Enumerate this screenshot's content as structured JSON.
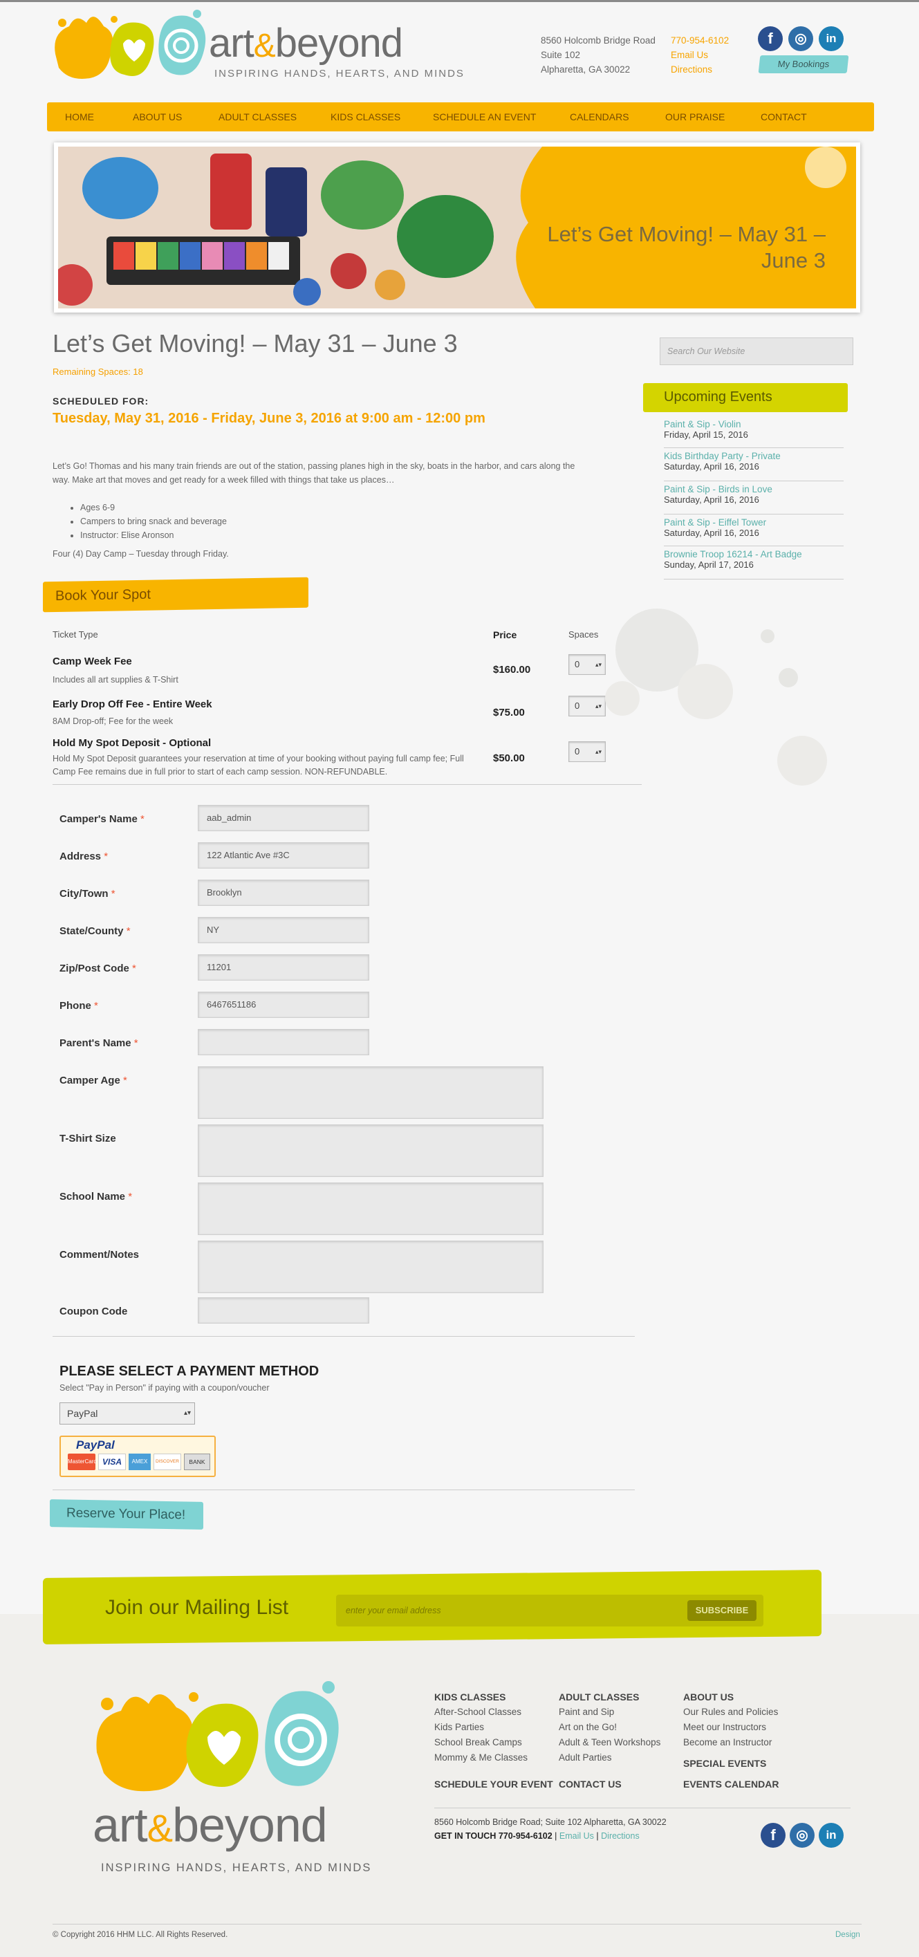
{
  "header": {
    "brand_art": "art",
    "brand_amp": "&",
    "brand_beyond": "beyond",
    "tagline": "INSPIRING HANDS, HEARTS, AND MINDS",
    "address_line1": "8560 Holcomb Bridge Road",
    "address_line2": "Suite 102",
    "address_line3": "Alpharetta, GA 30022",
    "phone": "770-954-6102",
    "email_link": "Email Us",
    "directions_link": "Directions",
    "my_bookings": "My Bookings",
    "social": {
      "facebook": "f",
      "instagram": "◎",
      "linkedin": "in"
    }
  },
  "nav": {
    "items": [
      "HOME",
      "ABOUT US",
      "ADULT CLASSES",
      "KIDS CLASSES",
      "SCHEDULE AN EVENT",
      "CALENDARS",
      "OUR PRAISE",
      "CONTACT"
    ]
  },
  "banner": {
    "title": "Let’s Get Moving! – May 31 – June 3"
  },
  "event": {
    "title": "Let’s Get Moving! – May 31 – June 3",
    "remaining": "Remaining Spaces: 18",
    "scheduled_label": "SCHEDULED FOR:",
    "scheduled_date": "Tuesday, May 31, 2016 - Friday, June 3, 2016 at 9:00 am - 12:00 pm",
    "description": "Let’s Go! Thomas and his many train friends are out of the station, passing planes high in the sky, boats in the harbor, and cars along the way. Make art that moves and get ready for a week filled with things that take us places…",
    "bullets": [
      "Ages 6-9",
      "Campers to bring snack and beverage",
      "Instructor: Elise Aronson"
    ],
    "day_camp_note": "Four (4) Day Camp – Tuesday through Friday."
  },
  "booking": {
    "section_title": "Book Your Spot",
    "col_ticket": "Ticket Type",
    "col_price": "Price",
    "col_spaces": "Spaces",
    "tickets": [
      {
        "name": "Camp Week Fee",
        "desc": "Includes all art supplies & T-Shirt",
        "price": "$160.00",
        "qty": "0"
      },
      {
        "name": "Early Drop Off Fee - Entire Week",
        "desc": "8AM Drop-off; Fee for the week",
        "price": "$75.00",
        "qty": "0"
      },
      {
        "name": "Hold My Spot Deposit - Optional",
        "desc": "Hold My Spot Deposit guarantees your reservation at time of your booking without paying full camp fee; Full Camp Fee remains due in full prior to start of each camp session. NON-REFUNDABLE.",
        "price": "$50.00",
        "qty": "0"
      }
    ]
  },
  "form": {
    "required_mark": "*",
    "fields": [
      {
        "label": "Camper's Name",
        "required": true,
        "value": "aab_admin"
      },
      {
        "label": "Address",
        "required": true,
        "value": "122 Atlantic Ave #3C"
      },
      {
        "label": "City/Town",
        "required": true,
        "value": "Brooklyn"
      },
      {
        "label": "State/County",
        "required": true,
        "value": "NY"
      },
      {
        "label": "Zip/Post Code",
        "required": true,
        "value": "11201"
      },
      {
        "label": "Phone",
        "required": true,
        "value": "6467651186"
      },
      {
        "label": "Parent's Name",
        "required": true,
        "value": ""
      }
    ],
    "textareas": [
      {
        "label": "Camper Age",
        "required": true
      },
      {
        "label": "T-Shirt Size",
        "required": false
      },
      {
        "label": "School Name",
        "required": true
      },
      {
        "label": "Comment/Notes",
        "required": false
      }
    ],
    "coupon_label": "Coupon Code",
    "coupon_value": ""
  },
  "payment": {
    "heading": "PLEASE SELECT A PAYMENT METHOD",
    "subtext": "Select \"Pay in Person\" if paying with a coupon/voucher",
    "selected": "PayPal",
    "paypal_logo": "PayPal",
    "cards": [
      "MasterCard",
      "VISA",
      "AMEX",
      "DISCOVER",
      "BANK"
    ],
    "reserve_button": "Reserve Your Place!"
  },
  "sidebar": {
    "search_placeholder": "Search Our Website",
    "upcoming_title": "Upcoming Events",
    "events": [
      {
        "title": "Paint & Sip - Violin",
        "date": "Friday, April 15, 2016"
      },
      {
        "title": "Kids Birthday Party - Private",
        "date": "Saturday, April 16, 2016"
      },
      {
        "title": "Paint & Sip - Birds in Love",
        "date": "Saturday, April 16, 2016"
      },
      {
        "title": "Paint & Sip - Eiffel Tower",
        "date": "Saturday, April 16, 2016"
      },
      {
        "title": "Brownie Troop 16214 - Art Badge",
        "date": "Sunday, April 17, 2016"
      }
    ]
  },
  "mailing": {
    "title": "Join our Mailing List",
    "placeholder": "enter your email address",
    "button": "SUBSCRIBE"
  },
  "footer": {
    "brand_art": "art",
    "brand_amp": "&",
    "brand_beyond": "beyond",
    "tagline": "INSPIRING HANDS, HEARTS, AND MINDS",
    "col1": {
      "heading": "KIDS CLASSES",
      "items": [
        "After-School Classes",
        "Kids Parties",
        "School Break Camps",
        "Mommy & Me Classes"
      ],
      "bottom": "SCHEDULE YOUR EVENT"
    },
    "col2": {
      "heading": "ADULT CLASSES",
      "items": [
        "Paint and Sip",
        "Art on the Go!",
        "Adult & Teen Workshops",
        "Adult Parties"
      ],
      "bottom": "CONTACT US"
    },
    "col3": {
      "heading": "ABOUT US",
      "items": [
        "Our Rules and Policies",
        "Meet our Instructors",
        "Become an Instructor"
      ],
      "mid": "SPECIAL EVENTS",
      "bottom": "EVENTS CALENDAR"
    },
    "address": "8560 Holcomb Bridge Road; Suite 102 Alpharetta, GA 30022",
    "get_in_touch": "GET IN TOUCH 770-954-6102",
    "sep": "|",
    "email_link": "Email Us",
    "directions_link": "Directions",
    "copyright": "© Copyright 2016 HHM LLC. All Rights Reserved.",
    "design": "Design"
  },
  "colors": {
    "accent_orange": "#f8b400",
    "accent_lime": "#cfd300",
    "accent_teal": "#7fd3d3",
    "link_teal": "#5ab0aa"
  }
}
